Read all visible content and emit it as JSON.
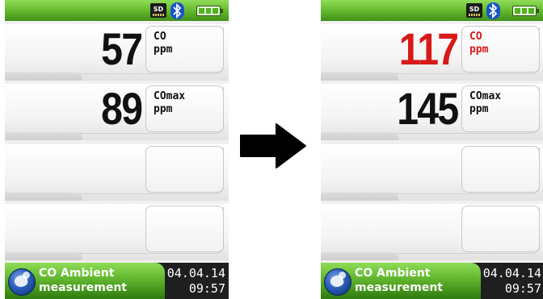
{
  "left": {
    "status": {
      "sd": "SD"
    },
    "panels": [
      {
        "value": "57",
        "gas": "CO",
        "unit": "ppm",
        "alert": false
      },
      {
        "value": "89",
        "gas": "COmax",
        "unit": "ppm",
        "alert": false
      },
      {
        "value": "",
        "gas": "",
        "unit": ""
      },
      {
        "value": "",
        "gas": "",
        "unit": ""
      }
    ],
    "mode": {
      "line1": "CO Ambient",
      "line2": "measurement"
    },
    "date": "04.04.14",
    "time": "09:57"
  },
  "right": {
    "status": {
      "sd": "SD"
    },
    "panels": [
      {
        "value": "117",
        "gas": "CO",
        "unit": "ppm",
        "alert": true
      },
      {
        "value": "145",
        "gas": "COmax",
        "unit": "ppm",
        "alert": false
      },
      {
        "value": "",
        "gas": "",
        "unit": ""
      },
      {
        "value": "",
        "gas": "",
        "unit": ""
      }
    ],
    "mode": {
      "line1": "CO Ambient",
      "line2": "measurement"
    },
    "date": "04.04.14",
    "time": "09:57"
  },
  "colors": {
    "status_green": "#62b62c",
    "alert_red": "#d81a1a",
    "bluetooth_blue": "#1a55c8"
  },
  "icons": {
    "sd": "sd-card-icon",
    "bluetooth": "bluetooth-icon",
    "battery": "battery-icon",
    "mode": "ambient-mode-icon",
    "transition": "right-arrow-icon"
  }
}
